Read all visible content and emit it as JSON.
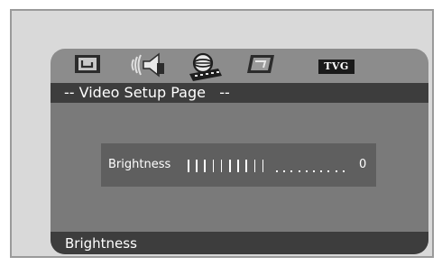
{
  "icons": {
    "tabs": [
      {
        "name": "general-setup-icon"
      },
      {
        "name": "audio-speaker-icon"
      },
      {
        "name": "video-setup-icon"
      },
      {
        "name": "preference-icon"
      }
    ],
    "tvg_label": "TVG"
  },
  "page": {
    "title": "-- Video Setup Page   --"
  },
  "setting": {
    "label": "Brightness",
    "value": "0",
    "level_on": 10,
    "level_total": 20
  },
  "status": {
    "text": "Brightness"
  },
  "colors": {
    "osd_background": "#8c8c8c",
    "title_bar": "#3d3d3d",
    "panel": "#5f5f5f",
    "text": "#ffffff"
  }
}
